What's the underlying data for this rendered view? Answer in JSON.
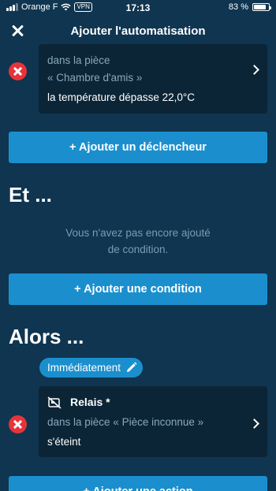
{
  "status_bar": {
    "carrier": "Orange F",
    "vpn": "VPN",
    "time": "17:13",
    "battery": "83 %",
    "battery_level": 0.83
  },
  "nav": {
    "title": "Ajouter l'automatisation"
  },
  "trigger_card": {
    "room_line": "dans la pièce",
    "room_name": "« Chambre d'amis »",
    "condition": "la température dépasse 22,0°C"
  },
  "buttons": {
    "add_trigger": "+ Ajouter un déclencheur",
    "add_condition": "+ Ajouter une condition",
    "add_action": "+ Ajouter une action"
  },
  "conditions_section": {
    "heading": "Et ...",
    "empty_line1": "Vous n'avez pas encore ajouté",
    "empty_line2": "de condition."
  },
  "actions_section": {
    "heading": "Alors ...",
    "timing_pill": "Immédiatement"
  },
  "action_card": {
    "device_name": "Relais *",
    "room_line": "dans la pièce « Pièce inconnue »",
    "action": "s'éteint"
  },
  "colors": {
    "background": "#0f3550",
    "card": "#0b2536",
    "accent": "#1b8fce",
    "remove": "#e8333a"
  }
}
